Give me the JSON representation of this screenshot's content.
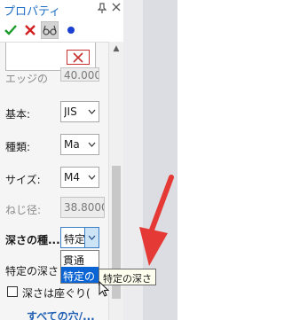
{
  "panel": {
    "title": "プロパティ",
    "title_buttons": [
      {
        "name": "pin-icon",
        "glyph": "⬇"
      },
      {
        "name": "close-icon",
        "glyph": "✕"
      }
    ]
  },
  "toolbar": {
    "buttons": [
      {
        "name": "ok-check-icon",
        "glyph": "✔",
        "color": "#1a9a2a"
      },
      {
        "name": "cancel-x-icon",
        "glyph": "✖",
        "color": "#d21f1f"
      },
      {
        "name": "glasses-preview-icon",
        "glyph": "∞",
        "color": "#444444"
      },
      {
        "name": "blue-dot-icon",
        "glyph": "●",
        "color": "#1a3fd1"
      }
    ]
  },
  "fields": {
    "partial_label": "エッジの",
    "partial_value": "40.0000",
    "standard_label": "基本:",
    "standard_value": "JIS",
    "type_label": "種類:",
    "type_value": "Ma",
    "size_label": "サイズ:",
    "size_value": "M4",
    "thread_dia_label": "ねじ径:",
    "thread_dia_value": "38.8000",
    "depth_type_label": "深さの種...",
    "depth_type_value": "特定",
    "depth_label": "特定の深さ",
    "seat_checkbox_label": "深さは座ぐり(",
    "more_link": "すべての穴/..."
  },
  "dropdown": {
    "options": [
      "貫通",
      "特定の"
    ],
    "selected_index": 1
  },
  "tooltip": "特定の深さ",
  "colors": {
    "accent": "#1f6fc5",
    "selection": "#0a64d4",
    "annotation_arrow": "#e53935"
  }
}
